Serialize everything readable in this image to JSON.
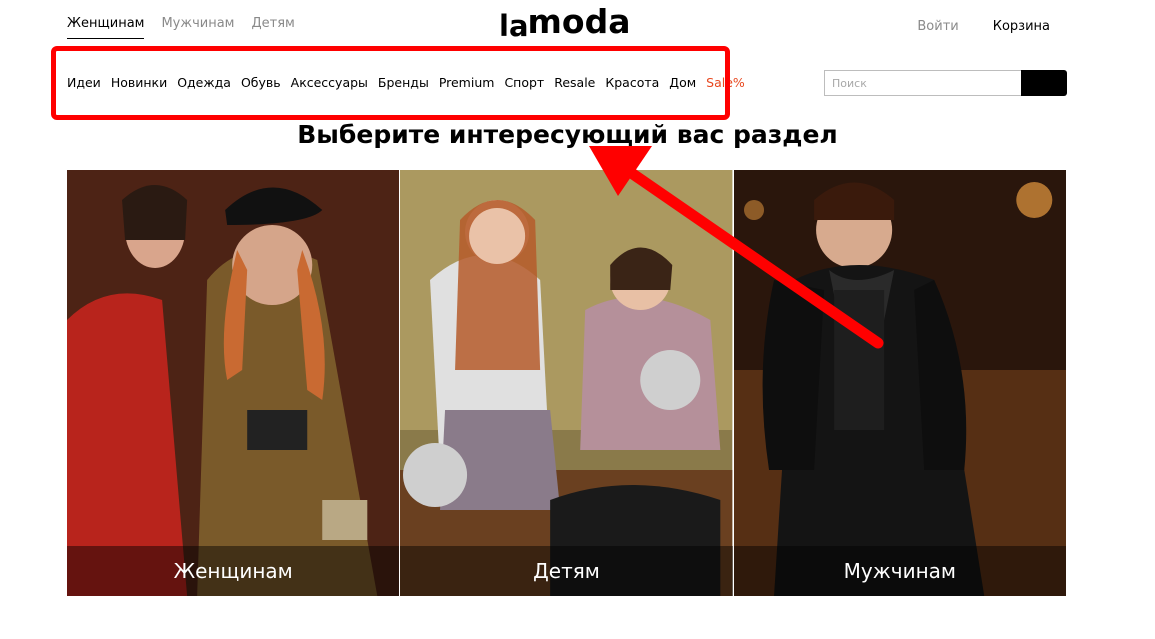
{
  "header": {
    "gender_tabs": [
      "Женщинам",
      "Мужчинам",
      "Детям"
    ],
    "logo_la": "la",
    "logo_moda": "moda",
    "login": "Войти",
    "cart": "Корзина"
  },
  "category_nav": {
    "items": [
      "Идеи",
      "Новинки",
      "Одежда",
      "Обувь",
      "Аксессуары",
      "Бренды",
      "Premium",
      "Спорт",
      "Resale",
      "Красота",
      "Дом",
      "Sale%"
    ],
    "sale_color": "#e8481f"
  },
  "search": {
    "placeholder": "Поиск"
  },
  "main": {
    "title": "Выберите интересующий вас раздел",
    "cards": [
      {
        "label": "Женщинам"
      },
      {
        "label": "Детям"
      },
      {
        "label": "Мужчинам"
      }
    ]
  },
  "annotation": {
    "color": "#ff0000"
  }
}
